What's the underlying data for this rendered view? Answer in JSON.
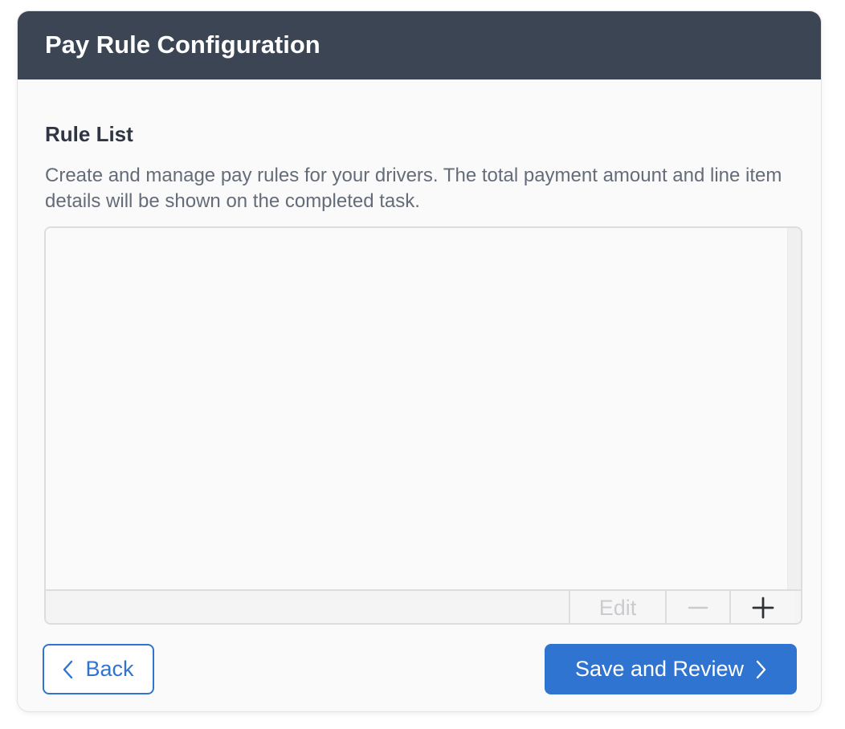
{
  "header": {
    "title": "Pay Rule Configuration"
  },
  "section": {
    "title": "Rule List",
    "description": "Create and manage pay rules for your drivers. The total payment amount and line item details will be shown on the completed task."
  },
  "rule_list": {
    "items": [],
    "toolbar": {
      "edit_label": "Edit",
      "remove_icon": "minus-icon",
      "add_icon": "plus-icon"
    }
  },
  "footer": {
    "back_label": "Back",
    "back_icon": "chevron-left-icon",
    "save_label": "Save and Review",
    "save_icon": "chevron-right-icon"
  },
  "colors": {
    "header_bg": "#3b4554",
    "primary": "#2f74d0",
    "disabled_text": "#c9cbcf"
  }
}
